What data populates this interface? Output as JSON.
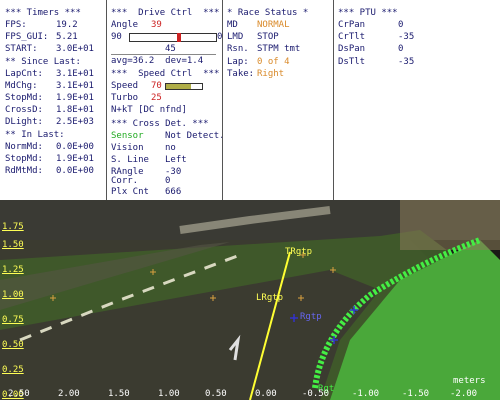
{
  "timers": {
    "header": "*** Timers ***",
    "rows": [
      {
        "label": "FPS:",
        "value": "19.2"
      },
      {
        "label": "FPS_GUI:",
        "value": "5.21"
      },
      {
        "label": "START:",
        "value": "3.0E+01"
      }
    ],
    "since_header": "** Since Last:",
    "since_rows": [
      {
        "label": "LapCnt:",
        "value": "3.1E+01"
      },
      {
        "label": "MdChg:",
        "value": "3.1E+01"
      },
      {
        "label": "StopMd:",
        "value": "1.9E+01"
      },
      {
        "label": "CrossD:",
        "value": "1.8E+01"
      },
      {
        "label": "DLight:",
        "value": "2.5E+03"
      }
    ],
    "in_header": "** In Last:",
    "in_rows": [
      {
        "label": "NormMd:",
        "value": "0.0E+00"
      },
      {
        "label": "StopMd:",
        "value": "1.9E+01"
      },
      {
        "label": "RdMtMd:",
        "value": "0.0E+00"
      }
    ]
  },
  "drive": {
    "header": "***  Drive Ctrl  ***",
    "angle_label": "Angle",
    "angle_value": "39",
    "slider_min": "90",
    "slider_max": "0",
    "slider_mid": "45",
    "slider_level": 0.57,
    "stats": "avg=36.2  dev=1.4",
    "speed_header": "***  Speed Ctrl  ***",
    "speed_label": "Speed",
    "speed_value": "70",
    "speed_level": 0.7,
    "turbo_label": "Turbo",
    "turbo_value": "25",
    "nkt": "N+kT [DC nfnd]",
    "cross_header": "*** Cross Det. ***",
    "cross_rows": [
      {
        "label": "Sensor",
        "value": "Not Detect."
      },
      {
        "label": "Vision",
        "value": "no"
      },
      {
        "label": "S. Line",
        "value": "Left"
      },
      {
        "label": "RAngle",
        "value": "-30"
      },
      {
        "label": "Corr.",
        "value": "0"
      },
      {
        "label": "Plx Cnt",
        "value": "666"
      }
    ]
  },
  "race": {
    "header": "* Race Status *",
    "rows": [
      {
        "label": "MD",
        "value": "NORMAL"
      },
      {
        "label": "LMD",
        "value": "STOP"
      },
      {
        "label": "Rsn.",
        "value": "STPM tmt"
      },
      {
        "label": "Lap:",
        "value": "0 of 4"
      },
      {
        "label": "Take:",
        "value": "Right"
      }
    ]
  },
  "ptu": {
    "header": "*** PTU ***",
    "rows": [
      {
        "label": "CrPan",
        "value": "0"
      },
      {
        "label": "CrTlt",
        "value": "-35"
      },
      {
        "label": "DsPan",
        "value": "0"
      },
      {
        "label": "DsTlt",
        "value": "-35"
      }
    ]
  },
  "overlay": {
    "y_ticks": [
      "1.75",
      "1.50",
      "1.25",
      "1.00",
      "0.75",
      "0.50",
      "0.25",
      "0.00"
    ],
    "x_ticks": [
      "2.50",
      "2.00",
      "1.50",
      "1.00",
      "0.50",
      "0.00",
      "-0.50",
      "-1.00",
      "-1.50",
      "-2.00"
    ],
    "units": "meters",
    "target_label": "TRgtp",
    "center_label": "LRgtp",
    "marker_label": "Rgtp",
    "edge_label": "Rgt",
    "colors": {
      "road": "#3f5a2a",
      "grass": "#4aa83a",
      "line": "#ffff33",
      "edge": "#44ee44",
      "marker": "#3333cc",
      "tick": "#ffff55"
    }
  }
}
